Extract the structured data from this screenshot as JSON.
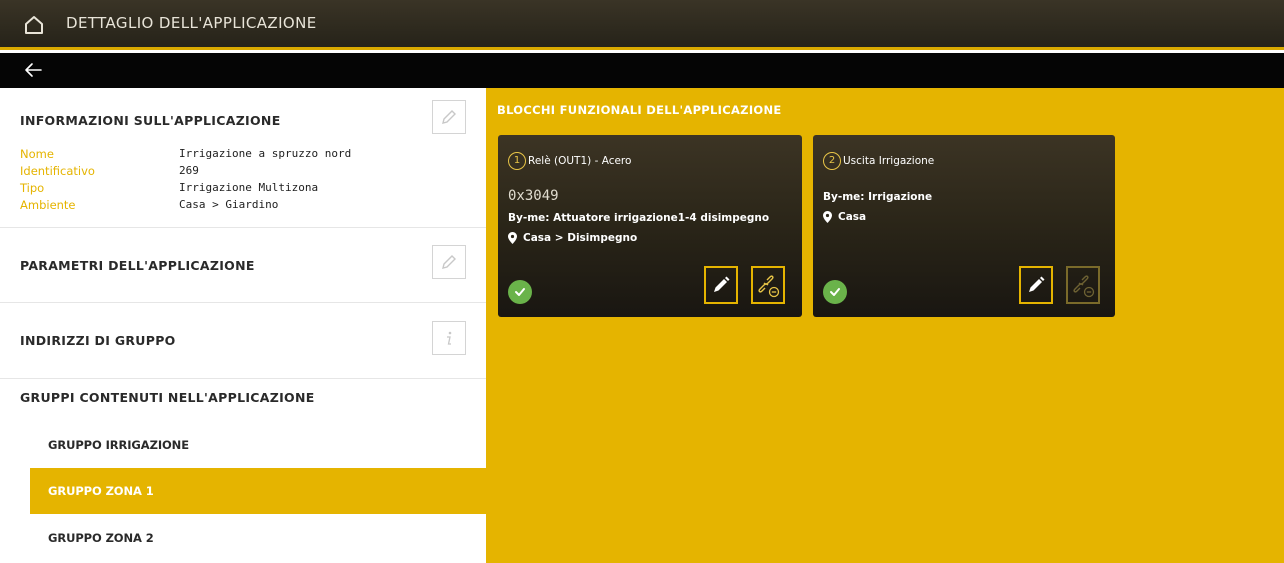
{
  "app": {
    "title": "DETTAGLIO DELL'APPLICAZIONE"
  },
  "left": {
    "info": {
      "heading": "INFORMAZIONI SULL'APPLICAZIONE",
      "rows": [
        {
          "key": "Nome",
          "value": "Irrigazione a spruzzo nord"
        },
        {
          "key": "Identificativo",
          "value": "269"
        },
        {
          "key": "Tipo",
          "value": "Irrigazione Multizona"
        },
        {
          "key": "Ambiente",
          "value": "Casa > Giardino"
        }
      ]
    },
    "params_heading": "PARAMETRI DELL'APPLICAZIONE",
    "addresses_heading": "INDIRIZZI DI GRUPPO",
    "groups_heading": "GRUPPI CONTENUTI NELL'APPLICAZIONE",
    "groups": [
      {
        "label": "GRUPPO IRRIGAZIONE",
        "active": false
      },
      {
        "label": "GRUPPO ZONA 1",
        "active": true
      },
      {
        "label": "GRUPPO ZONA 2",
        "active": false
      }
    ]
  },
  "right": {
    "heading": "BLOCCHI FUNZIONALI DELL'APPLICAZIONE",
    "cards": [
      {
        "number": "1",
        "name": "Relè (OUT1) - Acero",
        "address": "0x3049",
        "byme": "By-me: Attuatore irrigazione1-4 disimpegno",
        "location": "Casa > Disimpegno",
        "status": "ok",
        "unlink_enabled": true
      },
      {
        "number": "2",
        "name": "Uscita Irrigazione",
        "address": "",
        "byme": "By-me: Irrigazione",
        "location": "Casa",
        "status": "ok",
        "unlink_enabled": false
      }
    ]
  },
  "colors": {
    "accent": "#e5b400",
    "ok": "#6ab34a",
    "header_bg": "#262319"
  }
}
